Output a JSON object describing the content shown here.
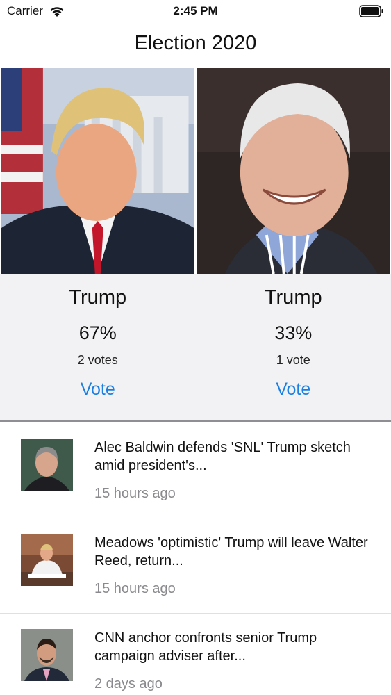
{
  "status_bar": {
    "carrier": "Carrier",
    "time": "2:45 PM"
  },
  "nav": {
    "title": "Election 2020"
  },
  "candidates": [
    {
      "name": "Trump",
      "percent": "67%",
      "votes": "2 votes",
      "vote_label": "Vote",
      "photo": "trump-portrait"
    },
    {
      "name": "Trump",
      "percent": "33%",
      "votes": "1 vote",
      "vote_label": "Vote",
      "photo": "biden-portrait"
    }
  ],
  "news": [
    {
      "title": "Alec Baldwin defends 'SNL' Trump sketch amid president's...",
      "time": "15 hours ago",
      "thumb": "baldwin-thumb"
    },
    {
      "title": "Meadows 'optimistic' Trump will leave Walter Reed, return...",
      "time": "15 hours ago",
      "thumb": "trump-desk-thumb"
    },
    {
      "title": "CNN anchor confronts senior Trump campaign adviser after...",
      "time": "2 days ago",
      "thumb": "adviser-thumb"
    }
  ],
  "colors": {
    "accent": "#1a7fe0",
    "panel_bg": "#f2f2f4",
    "secondary_text": "#8a8a8e"
  }
}
